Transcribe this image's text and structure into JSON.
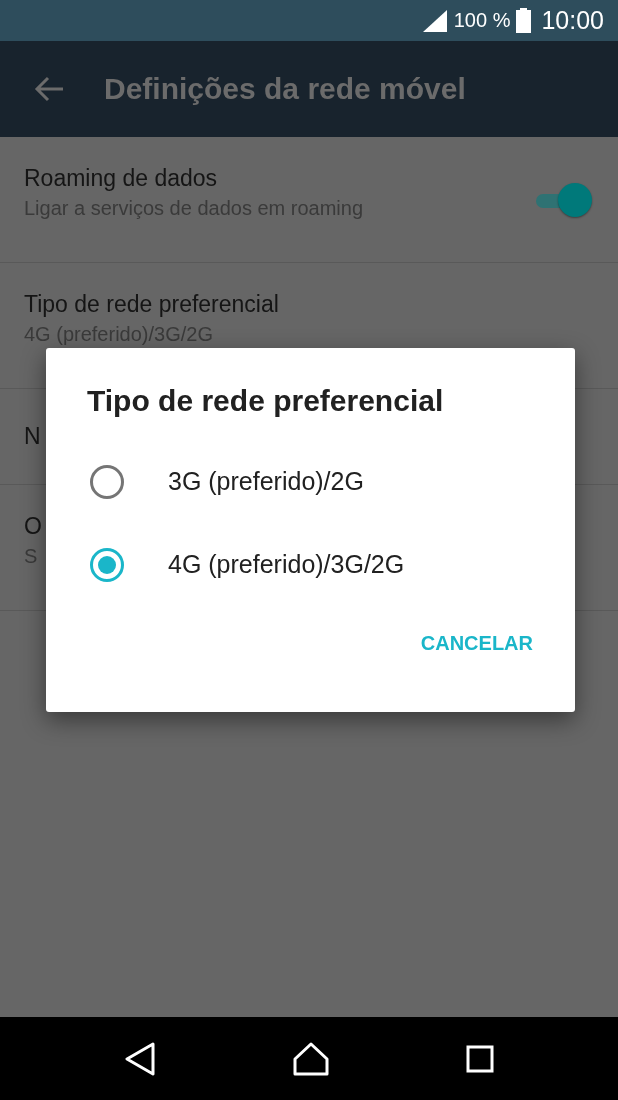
{
  "status_bar": {
    "battery": "100 %",
    "time": "10:00"
  },
  "app_bar": {
    "title": "Definições da rede móvel"
  },
  "settings": [
    {
      "kind": "toggle",
      "title": "Roaming de dados",
      "subtitle": "Ligar a serviços de dados em roaming",
      "on": true
    },
    {
      "kind": "text",
      "title": "Tipo de rede preferencial",
      "subtitle": "4G (preferido)/3G/2G"
    },
    {
      "kind": "text",
      "title": "N"
    },
    {
      "kind": "text",
      "title": "O",
      "subtitle": "S"
    }
  ],
  "dialog": {
    "title": "Tipo de rede preferencial",
    "options": [
      {
        "label": "3G (preferido)/2G",
        "selected": false
      },
      {
        "label": "4G (preferido)/3G/2G",
        "selected": true
      }
    ],
    "buttons": [
      "CANCELAR"
    ]
  }
}
